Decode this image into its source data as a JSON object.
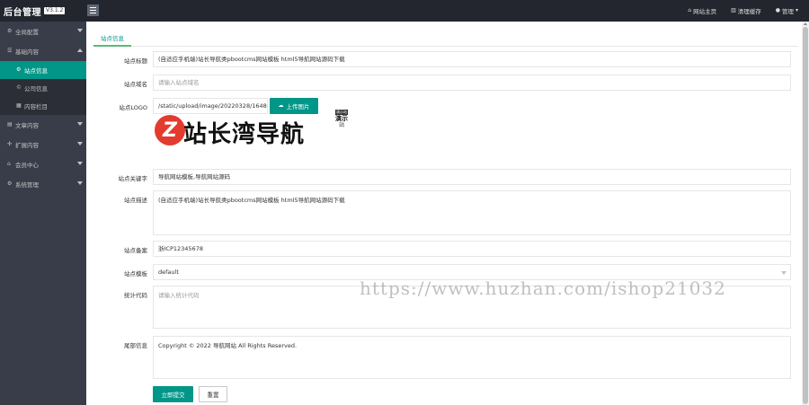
{
  "header": {
    "logo_text": "后台管理",
    "version": "V3.1.2",
    "site_home": "网站主页",
    "clear_cache": "清理缓存",
    "admin": "管理"
  },
  "sidebar": {
    "items": [
      {
        "label": "全局配置",
        "icon": "gear-icon"
      },
      {
        "label": "基础内容",
        "icon": "list-icon",
        "expanded": true
      },
      {
        "label": "文章内容",
        "icon": "document-icon"
      },
      {
        "label": "扩展内容",
        "icon": "puzzle-icon"
      },
      {
        "label": "会员中心",
        "icon": "user-icon"
      },
      {
        "label": "系统管理",
        "icon": "settings-icon"
      }
    ],
    "sub_items": [
      {
        "label": "站点信息",
        "active": true
      },
      {
        "label": "公司信息",
        "active": false
      },
      {
        "label": "内容栏目",
        "active": false
      }
    ]
  },
  "main": {
    "tab": "站点信息",
    "fields": {
      "title": {
        "label": "站点标题",
        "value": "(自适应手机端)站长导航类pbootcms网站模板 html5导航网站源码下载"
      },
      "domain": {
        "label": "站点域名",
        "placeholder": "请输入站点域名"
      },
      "logo": {
        "label": "站点LOGO",
        "value": "/static/upload/image/20220328/1648436",
        "upload_button": "上传图片"
      },
      "keywords": {
        "label": "站点关键字",
        "value": "导航网站模板,导航网站源码"
      },
      "description": {
        "label": "站点描述",
        "value": "(自适应手机端)站长导航类pbootcms网站模板 html5导航网站源码下载"
      },
      "icp": {
        "label": "站点备案",
        "value": "浙ICP12345678"
      },
      "template": {
        "label": "站点模板",
        "value": "default"
      },
      "stats": {
        "label": "统计代码",
        "placeholder": "请输入统计代码"
      },
      "footer": {
        "label": "尾部信息",
        "value": "Copyright © 2022 导航网站 All Rights Reserved."
      }
    },
    "submit": "立即提交",
    "reset": "重置",
    "logo_preview": {
      "letter": "Z",
      "brand": "站长湾导航",
      "stamp_top": "演示站",
      "stamp_mid": "演示",
      "stamp_bot": "站"
    }
  },
  "watermark": "https://www.huzhan.com/ishop21032",
  "colors": {
    "accent": "#009688",
    "sidebar_bg": "#393d49",
    "topbar_bg": "#23262e",
    "logo_red": "#e33b2e"
  }
}
